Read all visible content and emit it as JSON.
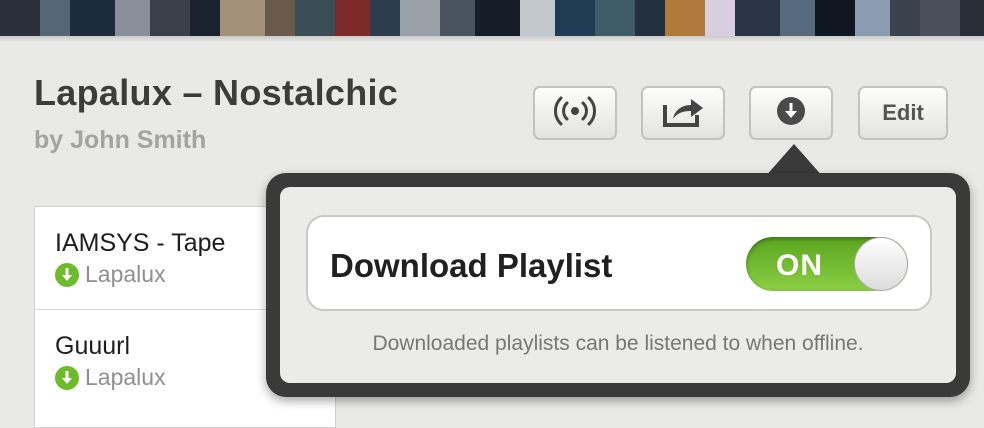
{
  "playlist": {
    "title": "Lapalux – Nostalchic",
    "byline": "by John Smith"
  },
  "toolbar": {
    "broadcast_icon": "broadcast-icon",
    "share_icon": "share-icon",
    "download_icon": "download-icon",
    "edit_label": "Edit"
  },
  "tracks": [
    {
      "title": "IAMSYS - Tape",
      "artist": "Lapalux",
      "downloaded": true
    },
    {
      "title": "Guuurl",
      "artist": "Lapalux",
      "downloaded": true
    }
  ],
  "download_popover": {
    "setting_label": "Download Playlist",
    "toggle_state": "ON",
    "hint": "Downloaded playlists can be listened to when offline."
  },
  "colors": {
    "toggle_on": "#7cc23a",
    "download_badge": "#6dba2b",
    "popover_frame": "#3a3a3a"
  }
}
